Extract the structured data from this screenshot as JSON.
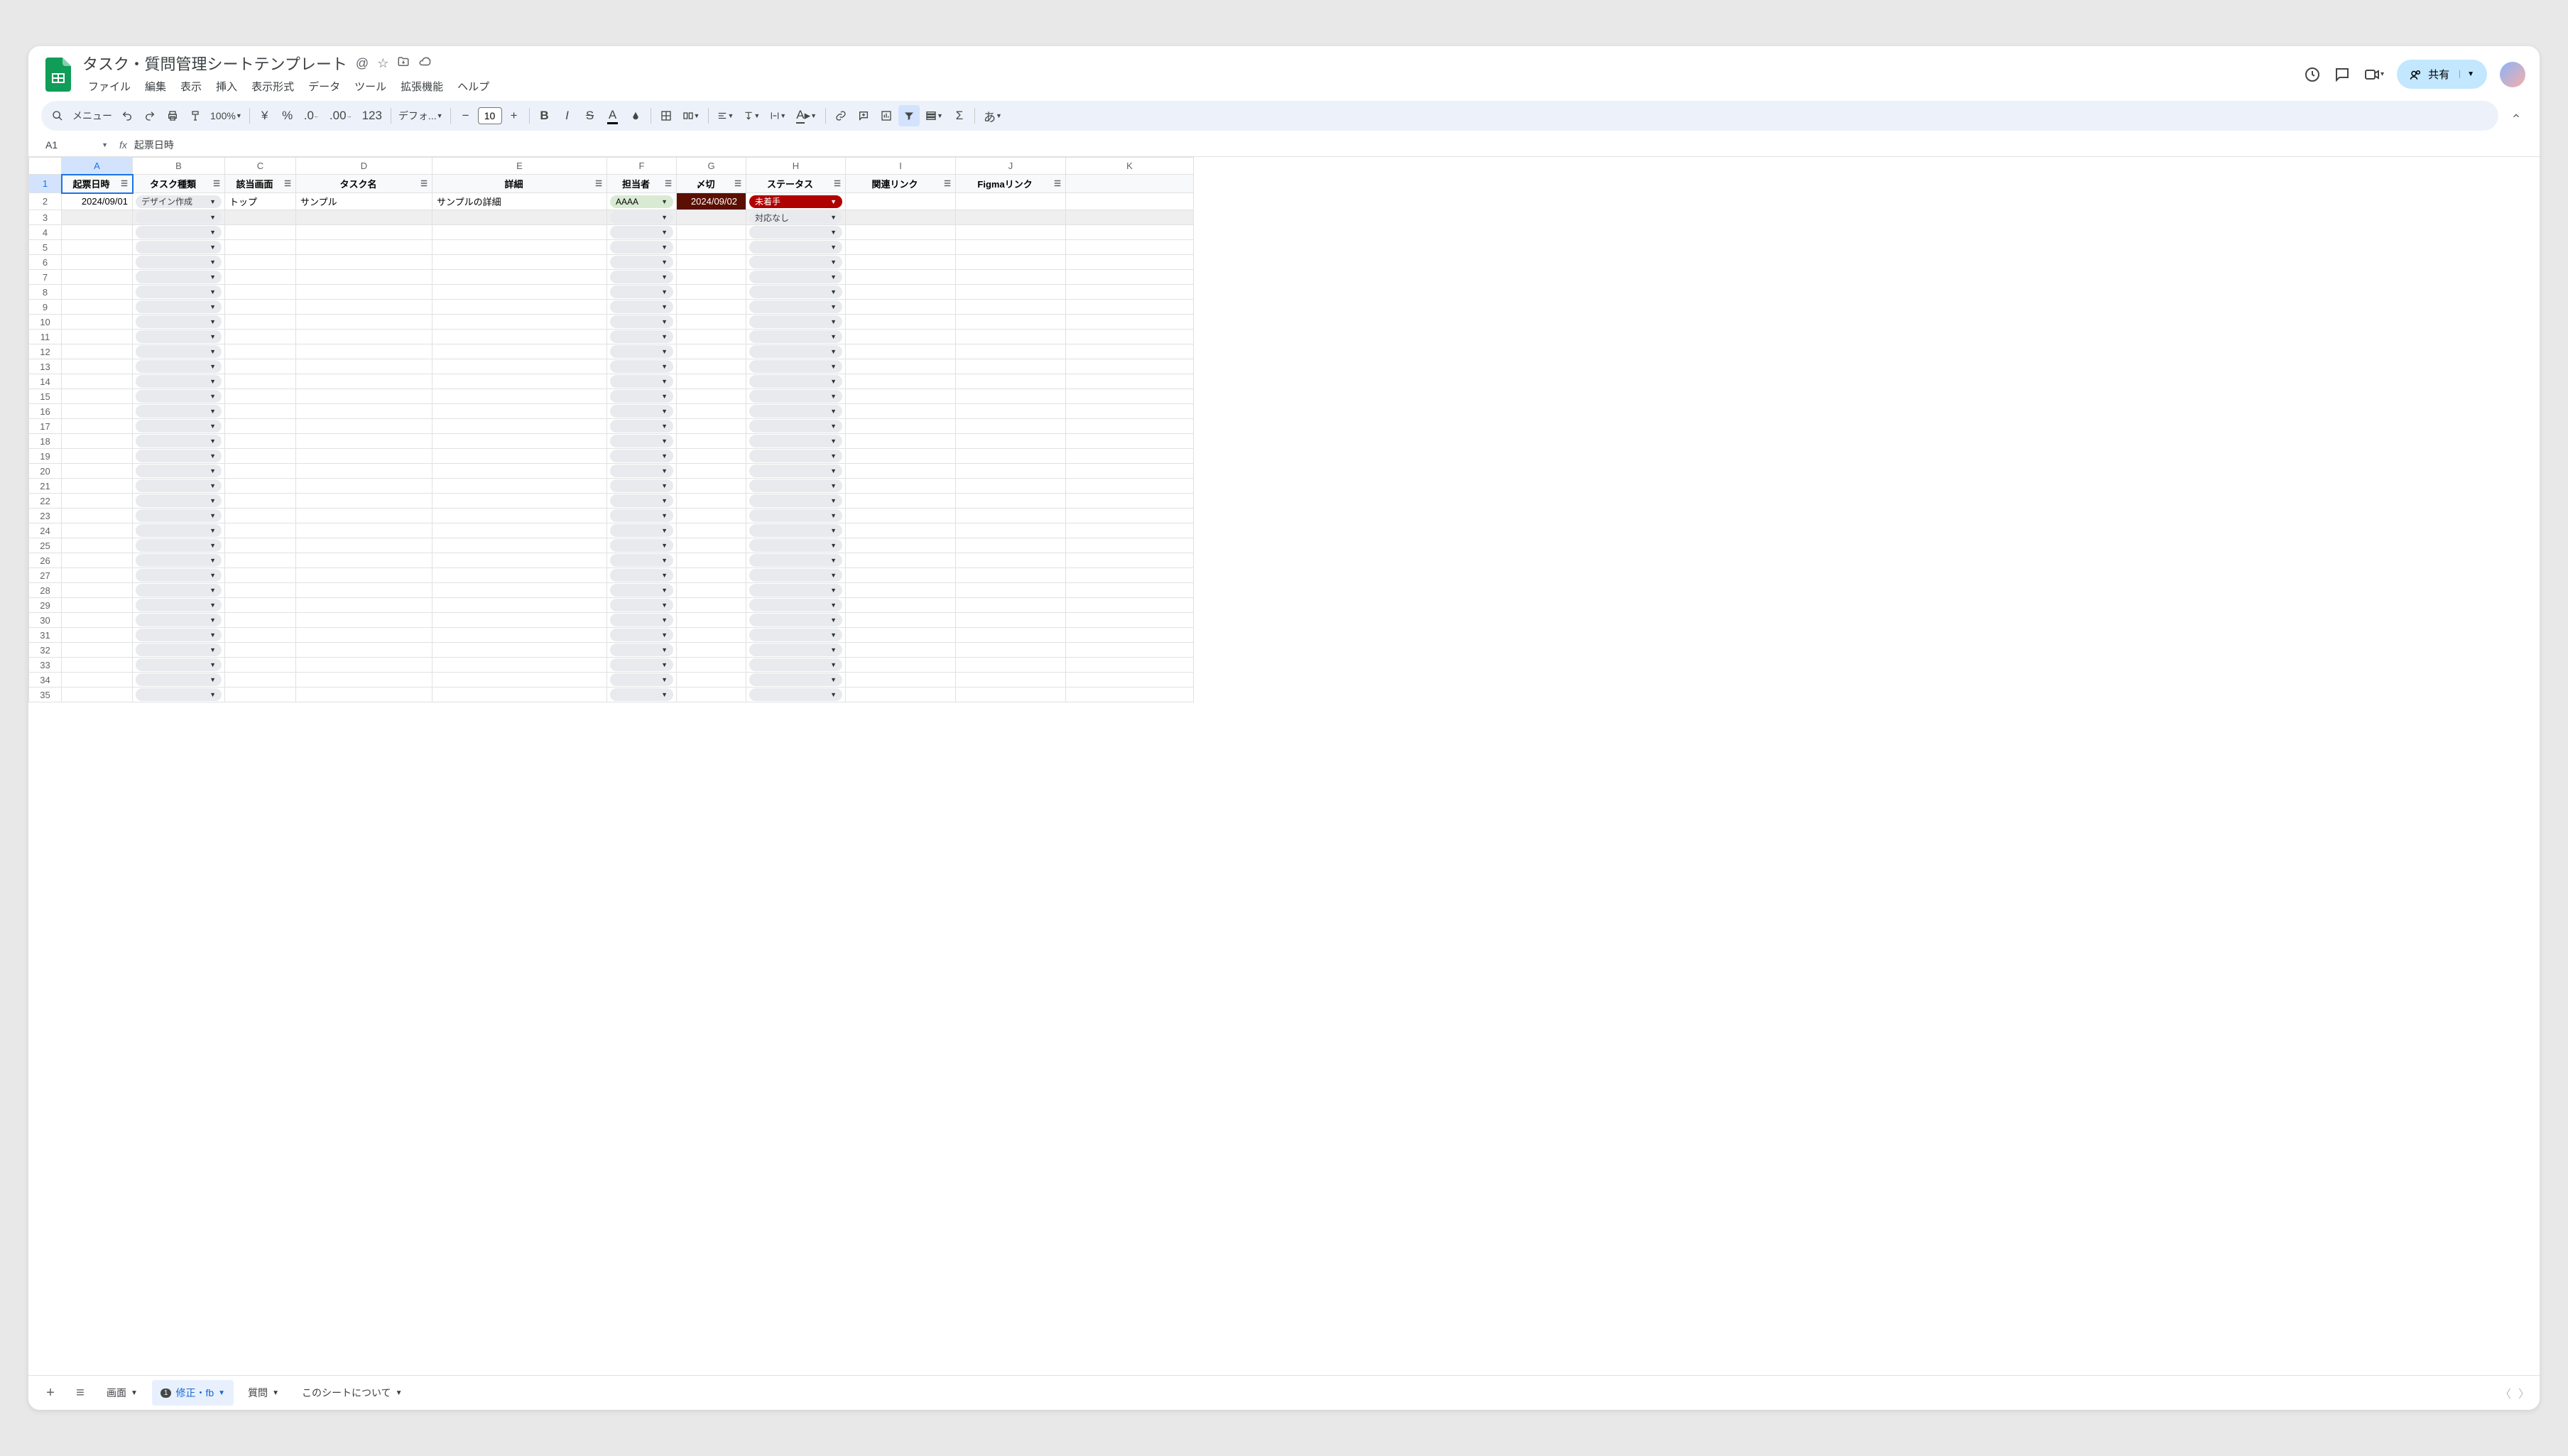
{
  "doc": {
    "title": "タスク・質問管理シートテンプレート"
  },
  "menus": [
    "ファイル",
    "編集",
    "表示",
    "挿入",
    "表示形式",
    "データ",
    "ツール",
    "拡張機能",
    "ヘルプ"
  ],
  "toolbar": {
    "search_label": "メニュー",
    "zoom": "100%",
    "font": "デフォ...",
    "fontsize": "10",
    "lang": "あ"
  },
  "share_label": "共有",
  "name_box": "A1",
  "formula_bar": "起票日時",
  "columns": [
    "A",
    "B",
    "C",
    "D",
    "E",
    "F",
    "G",
    "H",
    "I",
    "J",
    "K"
  ],
  "col_widths": [
    "colA",
    "colB",
    "colC",
    "colD",
    "colE",
    "colF",
    "colG",
    "colH",
    "colI",
    "colJ",
    "colK"
  ],
  "headers": [
    "起票日時",
    "タスク種類",
    "該当画面",
    "タスク名",
    "詳細",
    "担当者",
    "〆切",
    "ステータス",
    "関連リンク",
    "Figmaリンク",
    ""
  ],
  "row2": {
    "date": "2024/09/01",
    "type": "デザイン作成",
    "screen": "トップ",
    "name": "サンプル",
    "detail": "サンプルの詳細",
    "assignee": "AAAA",
    "deadline": "2024/09/02",
    "status": "未着手"
  },
  "row3": {
    "status": "対応なし"
  },
  "tabs": {
    "t1": "画面",
    "t2": "修正・fb",
    "t2_badge": "1",
    "t3": "質問",
    "t4": "このシートについて"
  }
}
